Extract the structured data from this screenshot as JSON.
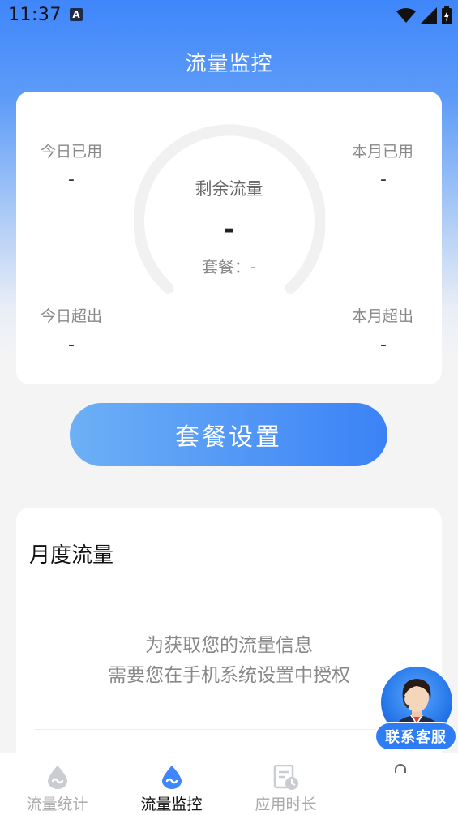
{
  "status_bar": {
    "time": "11:37",
    "badge": "A"
  },
  "header": {
    "title": "流量监控"
  },
  "stats": {
    "today_used": {
      "label": "今日已用",
      "value": "-"
    },
    "month_used": {
      "label": "本月已用",
      "value": "-"
    },
    "today_over": {
      "label": "今日超出",
      "value": "-"
    },
    "month_over": {
      "label": "本月超出",
      "value": "-"
    }
  },
  "gauge": {
    "title": "剩余流量",
    "value": "-",
    "package_label": "套餐：-"
  },
  "plan_button": {
    "label": "套餐设置"
  },
  "monthly": {
    "title": "月度流量",
    "message_line1": "为获取您的流量信息",
    "message_line2": "需要您在手机系统设置中授权"
  },
  "support": {
    "label": "联系客服"
  },
  "bottom_nav": {
    "items": [
      {
        "label": "流量统计",
        "active": false
      },
      {
        "label": "流量监控",
        "active": true
      },
      {
        "label": "应用时长",
        "active": false
      }
    ]
  },
  "colors": {
    "accent": "#3f86fb",
    "button_start": "#6db0f6",
    "button_end": "#3b82f6",
    "nav_active": "#111111",
    "nav_inactive": "#aaaaaa"
  }
}
